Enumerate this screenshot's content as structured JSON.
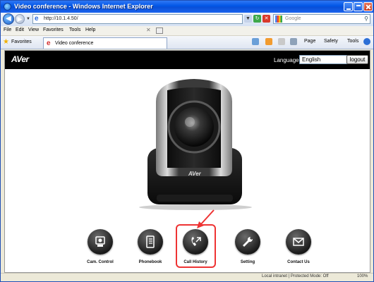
{
  "window": {
    "title": "Video conference - Windows Internet Explorer"
  },
  "address_bar": {
    "url": "http://10.1.4.50/",
    "search_placeholder": "Google"
  },
  "menu": [
    "File",
    "Edit",
    "View",
    "Favorites",
    "Tools",
    "Help"
  ],
  "favorites_bar": {
    "favorites_label": "Favorites",
    "tab_title": "Video conference",
    "commands": [
      "Page",
      "Safety",
      "Tools"
    ]
  },
  "page": {
    "logo": "AVer",
    "language_label": "Language",
    "language_value": "English",
    "logout_label": "logout",
    "camera_brand": "AVer",
    "features": [
      {
        "label": "Cam. Control",
        "icon": "camera-control-icon"
      },
      {
        "label": "Phonebook",
        "icon": "phonebook-icon"
      },
      {
        "label": "Call History",
        "icon": "call-history-icon",
        "highlighted": true
      },
      {
        "label": "Setting",
        "icon": "wrench-icon"
      },
      {
        "label": "Contact Us",
        "icon": "envelope-icon"
      }
    ]
  },
  "status_bar": {
    "zone": "Local intranet | Protected Mode: Off",
    "zoom": "100%"
  },
  "colors": {
    "header_bg": "#000000",
    "highlight": "#e33333",
    "titlebar": "#0055e5"
  }
}
